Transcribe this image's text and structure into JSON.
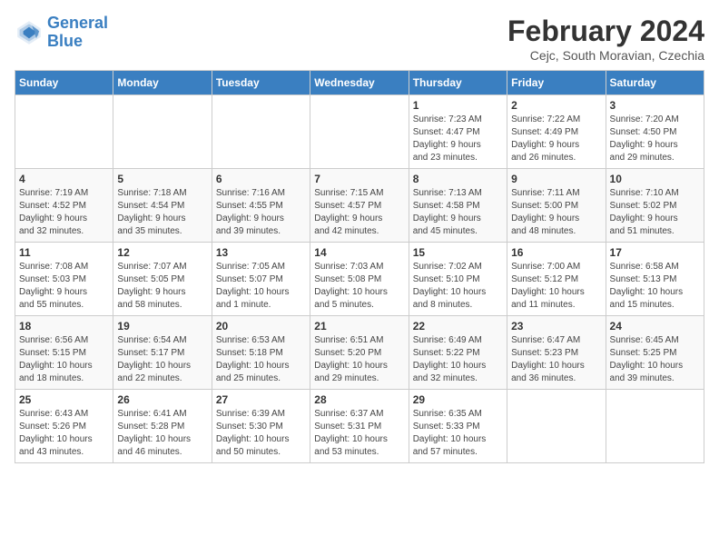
{
  "logo": {
    "text_general": "General",
    "text_blue": "Blue"
  },
  "header": {
    "month": "February 2024",
    "location": "Cejc, South Moravian, Czechia"
  },
  "days_of_week": [
    "Sunday",
    "Monday",
    "Tuesday",
    "Wednesday",
    "Thursday",
    "Friday",
    "Saturday"
  ],
  "weeks": [
    [
      {
        "day": "",
        "info": ""
      },
      {
        "day": "",
        "info": ""
      },
      {
        "day": "",
        "info": ""
      },
      {
        "day": "",
        "info": ""
      },
      {
        "day": "1",
        "info": "Sunrise: 7:23 AM\nSunset: 4:47 PM\nDaylight: 9 hours\nand 23 minutes."
      },
      {
        "day": "2",
        "info": "Sunrise: 7:22 AM\nSunset: 4:49 PM\nDaylight: 9 hours\nand 26 minutes."
      },
      {
        "day": "3",
        "info": "Sunrise: 7:20 AM\nSunset: 4:50 PM\nDaylight: 9 hours\nand 29 minutes."
      }
    ],
    [
      {
        "day": "4",
        "info": "Sunrise: 7:19 AM\nSunset: 4:52 PM\nDaylight: 9 hours\nand 32 minutes."
      },
      {
        "day": "5",
        "info": "Sunrise: 7:18 AM\nSunset: 4:54 PM\nDaylight: 9 hours\nand 35 minutes."
      },
      {
        "day": "6",
        "info": "Sunrise: 7:16 AM\nSunset: 4:55 PM\nDaylight: 9 hours\nand 39 minutes."
      },
      {
        "day": "7",
        "info": "Sunrise: 7:15 AM\nSunset: 4:57 PM\nDaylight: 9 hours\nand 42 minutes."
      },
      {
        "day": "8",
        "info": "Sunrise: 7:13 AM\nSunset: 4:58 PM\nDaylight: 9 hours\nand 45 minutes."
      },
      {
        "day": "9",
        "info": "Sunrise: 7:11 AM\nSunset: 5:00 PM\nDaylight: 9 hours\nand 48 minutes."
      },
      {
        "day": "10",
        "info": "Sunrise: 7:10 AM\nSunset: 5:02 PM\nDaylight: 9 hours\nand 51 minutes."
      }
    ],
    [
      {
        "day": "11",
        "info": "Sunrise: 7:08 AM\nSunset: 5:03 PM\nDaylight: 9 hours\nand 55 minutes."
      },
      {
        "day": "12",
        "info": "Sunrise: 7:07 AM\nSunset: 5:05 PM\nDaylight: 9 hours\nand 58 minutes."
      },
      {
        "day": "13",
        "info": "Sunrise: 7:05 AM\nSunset: 5:07 PM\nDaylight: 10 hours\nand 1 minute."
      },
      {
        "day": "14",
        "info": "Sunrise: 7:03 AM\nSunset: 5:08 PM\nDaylight: 10 hours\nand 5 minutes."
      },
      {
        "day": "15",
        "info": "Sunrise: 7:02 AM\nSunset: 5:10 PM\nDaylight: 10 hours\nand 8 minutes."
      },
      {
        "day": "16",
        "info": "Sunrise: 7:00 AM\nSunset: 5:12 PM\nDaylight: 10 hours\nand 11 minutes."
      },
      {
        "day": "17",
        "info": "Sunrise: 6:58 AM\nSunset: 5:13 PM\nDaylight: 10 hours\nand 15 minutes."
      }
    ],
    [
      {
        "day": "18",
        "info": "Sunrise: 6:56 AM\nSunset: 5:15 PM\nDaylight: 10 hours\nand 18 minutes."
      },
      {
        "day": "19",
        "info": "Sunrise: 6:54 AM\nSunset: 5:17 PM\nDaylight: 10 hours\nand 22 minutes."
      },
      {
        "day": "20",
        "info": "Sunrise: 6:53 AM\nSunset: 5:18 PM\nDaylight: 10 hours\nand 25 minutes."
      },
      {
        "day": "21",
        "info": "Sunrise: 6:51 AM\nSunset: 5:20 PM\nDaylight: 10 hours\nand 29 minutes."
      },
      {
        "day": "22",
        "info": "Sunrise: 6:49 AM\nSunset: 5:22 PM\nDaylight: 10 hours\nand 32 minutes."
      },
      {
        "day": "23",
        "info": "Sunrise: 6:47 AM\nSunset: 5:23 PM\nDaylight: 10 hours\nand 36 minutes."
      },
      {
        "day": "24",
        "info": "Sunrise: 6:45 AM\nSunset: 5:25 PM\nDaylight: 10 hours\nand 39 minutes."
      }
    ],
    [
      {
        "day": "25",
        "info": "Sunrise: 6:43 AM\nSunset: 5:26 PM\nDaylight: 10 hours\nand 43 minutes."
      },
      {
        "day": "26",
        "info": "Sunrise: 6:41 AM\nSunset: 5:28 PM\nDaylight: 10 hours\nand 46 minutes."
      },
      {
        "day": "27",
        "info": "Sunrise: 6:39 AM\nSunset: 5:30 PM\nDaylight: 10 hours\nand 50 minutes."
      },
      {
        "day": "28",
        "info": "Sunrise: 6:37 AM\nSunset: 5:31 PM\nDaylight: 10 hours\nand 53 minutes."
      },
      {
        "day": "29",
        "info": "Sunrise: 6:35 AM\nSunset: 5:33 PM\nDaylight: 10 hours\nand 57 minutes."
      },
      {
        "day": "",
        "info": ""
      },
      {
        "day": "",
        "info": ""
      }
    ]
  ]
}
